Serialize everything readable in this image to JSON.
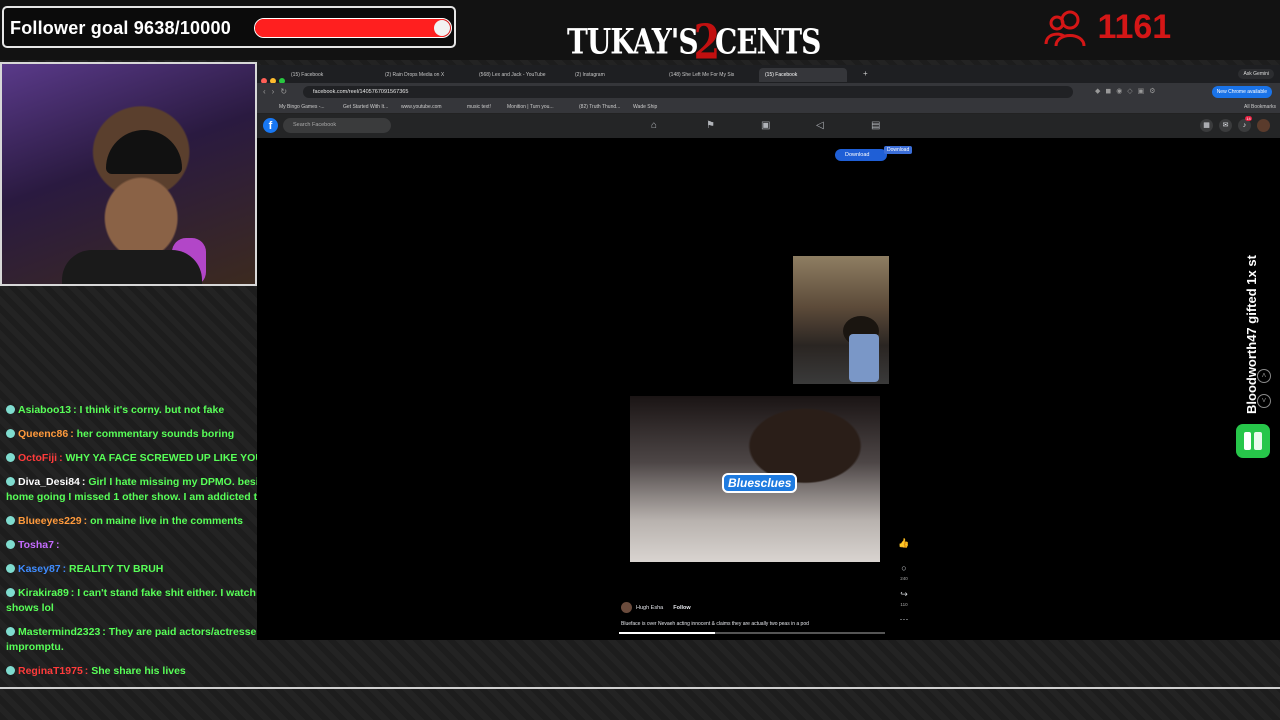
{
  "overlay": {
    "follower_goal_label": "Follower goal 9638/10000",
    "follower_goal_fraction": 0.9638,
    "logo_left": "TUKAY'S",
    "logo_two": "2",
    "logo_right": "CENTS",
    "viewer_count": "1161",
    "gift_alert": "Bloodworth47 gifted 1x st",
    "accent_color": "#d41616"
  },
  "chat": [
    {
      "user": "Asiaboo13",
      "message": "I think it's corny. but not fake",
      "user_color": "#58ff58"
    },
    {
      "user": "Queenc86",
      "message": "her commentary sounds boring",
      "user_color": "#ff9a3c"
    },
    {
      "user": "OctoFiji",
      "message": "WHY YA FACE SCREWED UP LIKE YOU SEE AN OPP??",
      "user_color": "#ff3b3b"
    },
    {
      "user": "Diva_Desi84",
      "message": "Girl I hate missing my DPMO. besides my Bonus Moms home going I missed 1 other show. I am addicted to DPMO",
      "user_color": "#ffffff"
    },
    {
      "user": "Blueeyes229",
      "message": "on maine live in the comments",
      "user_color": "#ff9a3c"
    },
    {
      "user": "Tosha7",
      "message": "",
      "user_color": "#c46bff"
    },
    {
      "user": "Kasey87",
      "message": "REALITY TV BRUH",
      "user_color": "#3f8cff"
    },
    {
      "user": "Kirakira89",
      "message": "I can't stand fake shit either. I watch nothing but crime shows lol",
      "user_color": "#58ff58"
    },
    {
      "user": "Mastermind2323",
      "message": "They are paid actors/actresses / scripted with impromptu.",
      "user_color": "#58ff58"
    },
    {
      "user": "ReginaT1975",
      "message": "She share his lives",
      "user_color": "#ff3b3b"
    }
  ],
  "browser": {
    "tabs": [
      {
        "label": "(15) Facebook",
        "active": false
      },
      {
        "label": "(2) Rain Drops Media on X",
        "active": false
      },
      {
        "label": "(568) Lex and Jack - YouTube",
        "active": false
      },
      {
        "label": "(2) Instagram",
        "active": false
      },
      {
        "label": "(148) She Left Me For My Sis",
        "active": false
      },
      {
        "label": "(15) Facebook",
        "active": true
      }
    ],
    "tab_plus": "+",
    "ask_gemini": "Ask Gemini",
    "url": "facebook.com/reel/1405767091567365",
    "new_chrome": "New Chrome available",
    "bookmarks": [
      "My Bingo Games -...",
      "Get Started With It...",
      "www.youtube.com",
      "music text!",
      "Monition | Turn you...",
      "(82) Truth Thund...",
      "Wade Ship"
    ],
    "all_bookmarks": "All Bookmarks",
    "fb_search_placeholder": "Search Facebook",
    "fb_notification_count": "14",
    "download_button": "Download",
    "download_chip": "Download",
    "video_label": "Bluesclues",
    "reel_comment_count": "240",
    "reel_share_count": "110",
    "author_name": "Hugh Esha",
    "follow_label": "Follow",
    "caption": "Blueface is over Nevaeh acting innocent & claims they are actually two peas in a pod",
    "playback_progress": 0.36
  }
}
